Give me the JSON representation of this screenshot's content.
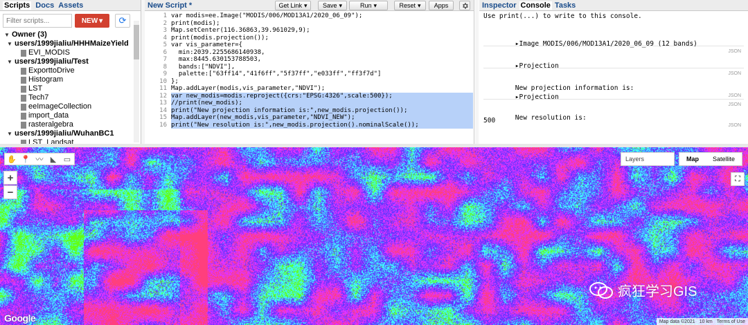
{
  "left_panel": {
    "tabs": [
      "Scripts",
      "Docs",
      "Assets"
    ],
    "filter_placeholder": "Filter scripts...",
    "new_label": "NEW",
    "tree": [
      {
        "label": "Owner (3)",
        "level": 0,
        "bold": true,
        "caret": "▼"
      },
      {
        "label": "users/1999jialiu/HHHMaizeYield",
        "level": 1,
        "bold": true,
        "caret": "▼"
      },
      {
        "label": "EVI_MODIS",
        "level": 2,
        "bold": false,
        "caret": ""
      },
      {
        "label": "users/1999jialiu/Test",
        "level": 1,
        "bold": true,
        "caret": "▼"
      },
      {
        "label": "ExporttoDrive",
        "level": 2,
        "bold": false,
        "caret": ""
      },
      {
        "label": "Histogram",
        "level": 2,
        "bold": false,
        "caret": ""
      },
      {
        "label": "LST",
        "level": 2,
        "bold": false,
        "caret": ""
      },
      {
        "label": "Tech7",
        "level": 2,
        "bold": false,
        "caret": ""
      },
      {
        "label": "eeImageCollection",
        "level": 2,
        "bold": false,
        "caret": ""
      },
      {
        "label": "import_data",
        "level": 2,
        "bold": false,
        "caret": ""
      },
      {
        "label": "rasteralgebra",
        "level": 2,
        "bold": false,
        "caret": ""
      },
      {
        "label": "users/1999jialiu/WuhanBC1",
        "level": 1,
        "bold": true,
        "caret": "▼"
      },
      {
        "label": "LST_Landsat",
        "level": 2,
        "bold": false,
        "caret": ""
      }
    ]
  },
  "code_panel": {
    "title": "New Script *",
    "buttons": [
      "Get Link",
      "Save",
      "Run",
      "Reset",
      "Apps"
    ],
    "line_numbers": [
      "1",
      "2",
      "3",
      "4",
      "5",
      "6",
      "7",
      "8",
      "9",
      "10",
      "11",
      "12",
      "13",
      "14",
      "15",
      "16"
    ],
    "lines": [
      "var modis=ee.Image(\"MODIS/006/MOD13A1/2020_06_09\");",
      "print(modis);",
      "Map.setCenter(116.36863,39.961029,9);",
      "print(modis.projection());",
      "var vis_parameter={",
      "  min:2039.2255686140938,",
      "  max:8445.630153788503,",
      "  bands:[\"NDVI\"],",
      "  palette:[\"63ff14\",\"41f6ff\",\"5f37ff\",\"e033ff\",\"ff3f7d\"]",
      "};",
      "Map.addLayer(modis,vis_parameter,\"NDVI\");",
      "var new_modis=modis.reproject({crs:\"EPSG:4326\",scale:500});",
      "//print(new_modis);",
      "print(\"New projection information is:\",new_modis.projection());",
      "Map.addLayer(new_modis,vis_parameter,\"NDVI_NEW\");",
      "print(\"New resolution is:\",new_modis.projection().nominalScale());"
    ]
  },
  "right_panel": {
    "tabs": [
      "Inspector",
      "Console",
      "Tasks"
    ],
    "hint": "Use print(...) to write to this console.",
    "image_entry": "Image MODIS/006/MOD13A1/2020_06_09 (12 bands)",
    "projection_1": "Projection",
    "new_proj_label": "New projection information is:",
    "projection_2": "Projection",
    "new_res_label": "New resolution is:",
    "new_res_value": "500",
    "json_label": "JSON"
  },
  "map": {
    "layers_label": "Layers",
    "map_label": "Map",
    "satellite_label": "Satellite",
    "zoom_in": "+",
    "zoom_out": "−",
    "google": "Google",
    "attribution": [
      "Map data ©2021",
      "10 km",
      "Terms of Use"
    ],
    "watermark": "疯狂学习GIS",
    "palette": [
      "#63ff14",
      "#41f6ff",
      "#5f37ff",
      "#e033ff",
      "#ff3f7d"
    ]
  }
}
